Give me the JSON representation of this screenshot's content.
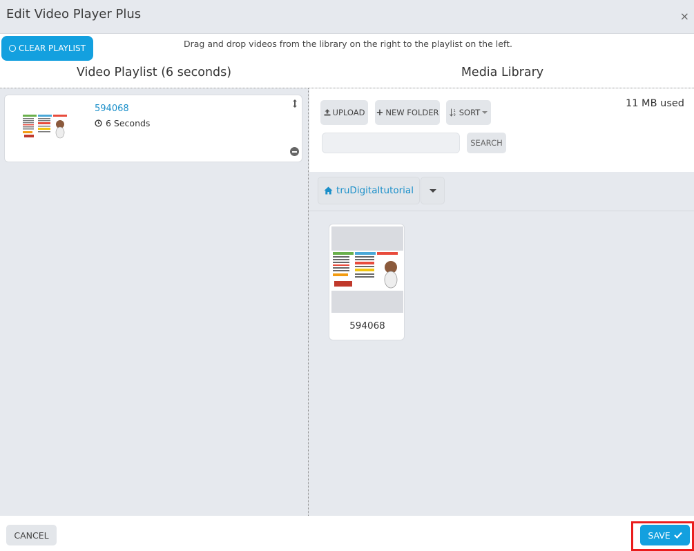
{
  "dialog": {
    "title": "Edit Video Player Plus",
    "close_glyph": "×"
  },
  "toolbar": {
    "clear_playlist_label": "CLEAR PLAYLIST",
    "hint": "Drag and drop videos from the library on the right to the playlist on the left."
  },
  "playlist": {
    "heading": "Video Playlist (6 seconds)",
    "items": [
      {
        "name": "594068",
        "duration": "6 Seconds"
      }
    ]
  },
  "library": {
    "heading": "Media Library",
    "upload_label": "UPLOAD",
    "new_folder_label": "NEW FOLDER",
    "sort_label": "SORT",
    "usage": "11 MB used",
    "search_placeholder": "",
    "search_label": "SEARCH",
    "folder": "truDigitaltutorial",
    "items": [
      {
        "name": "594068"
      }
    ]
  },
  "footer": {
    "cancel_label": "CANCEL",
    "save_label": "SAVE"
  },
  "colors": {
    "accent": "#13a0df",
    "link": "#1a8fc9",
    "highlight": "#ea1c1c"
  },
  "icons": [
    "close-icon",
    "circle-icon",
    "clock-icon",
    "drag-handle-icon",
    "remove-icon",
    "upload-icon",
    "plus-icon",
    "sort-icon",
    "home-icon",
    "caret-down-icon",
    "check-icon"
  ]
}
